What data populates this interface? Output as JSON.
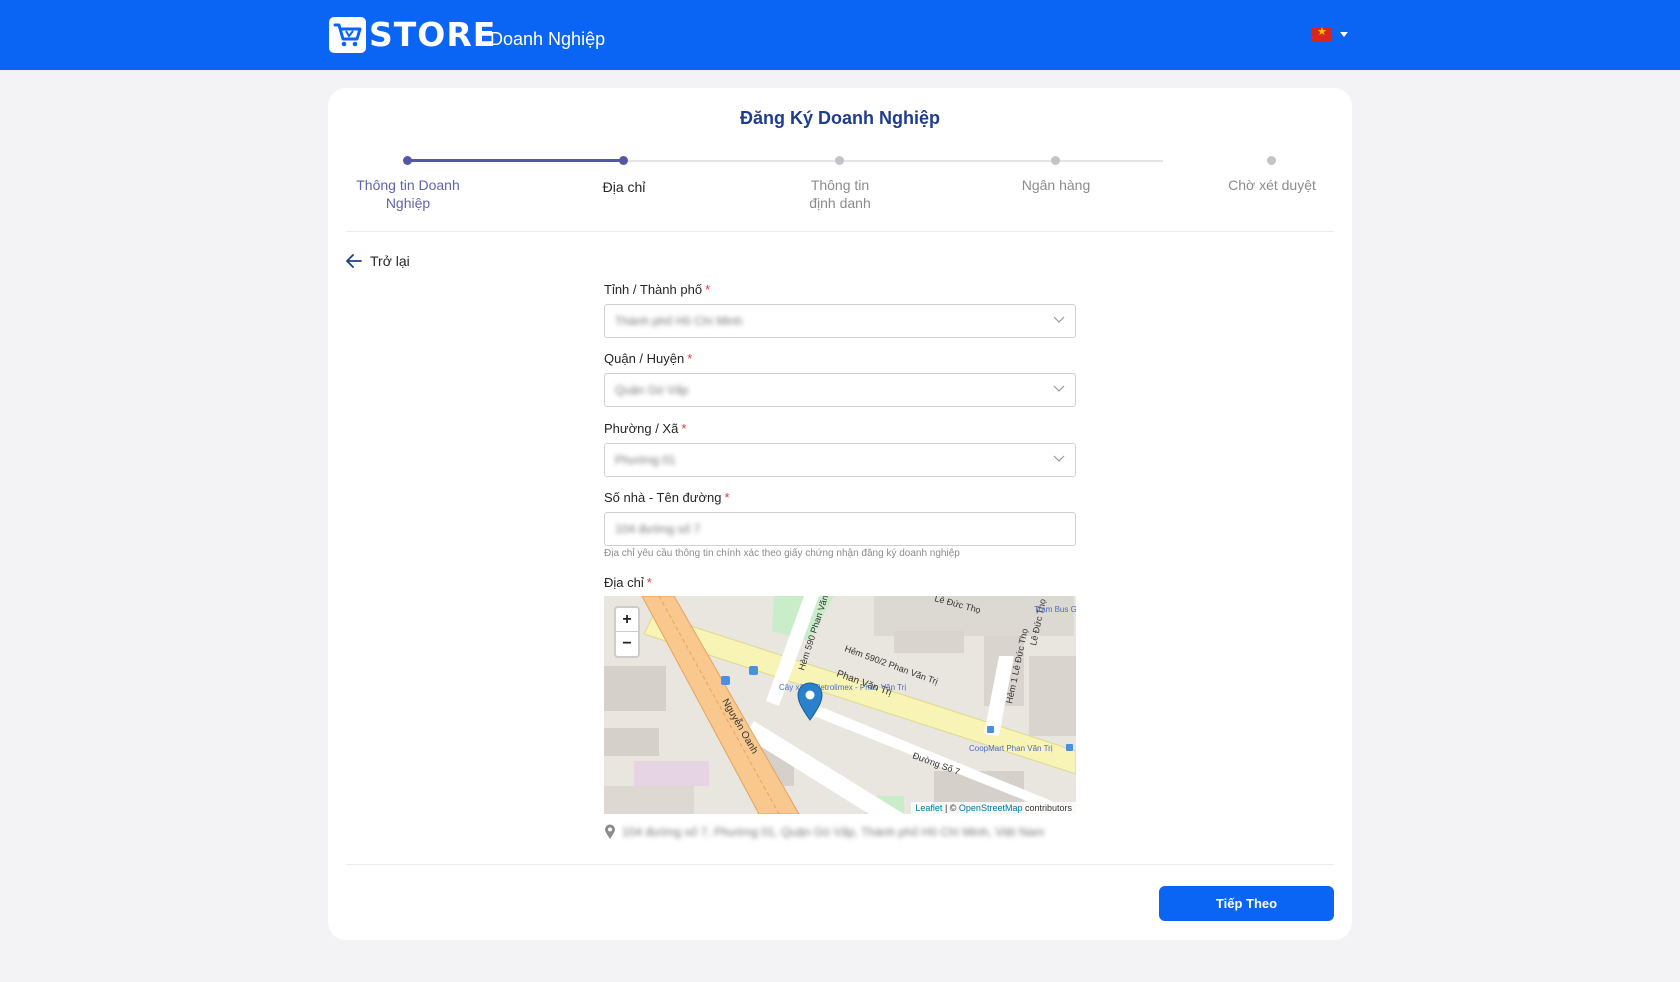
{
  "header": {
    "logo_text": "STORE",
    "subtitle": "Doanh Nghiệp",
    "language_flag": "vn-flag-icon",
    "accent_color": "#0a65f5"
  },
  "page": {
    "title": "Đăng Ký Doanh Nghiệp"
  },
  "steps": [
    {
      "label": "Thông tin Doanh Nghiệp",
      "state": "done"
    },
    {
      "label": "Địa chỉ",
      "state": "active"
    },
    {
      "label": "Thông tin định danh",
      "state": "pending"
    },
    {
      "label": "Ngân hàng",
      "state": "pending"
    },
    {
      "label": "Chờ xét duyệt",
      "state": "pending"
    }
  ],
  "back": {
    "label": "Trở lại"
  },
  "form": {
    "province": {
      "label": "Tỉnh / Thành phố",
      "required": "*",
      "value": "Thành phố Hồ Chí Minh"
    },
    "district": {
      "label": "Quận / Huyện",
      "required": "*",
      "value": "Quận Gò Vấp"
    },
    "ward": {
      "label": "Phường / Xã",
      "required": "*",
      "value": "Phường 01"
    },
    "street": {
      "label": "Số nhà - Tên đường",
      "required": "*",
      "value": "104 đường số 7",
      "hint": "Địa chỉ yêu cầu thông tin chính xác theo giấy chứng nhận đăng ký doanh nghiệp"
    },
    "address": {
      "label": "Địa chỉ",
      "required": "*",
      "value": "104 đường số 7, Phường 01, Quận Gò Vấp, Thành phố Hồ Chí Minh, Việt Nam"
    }
  },
  "map": {
    "zoom_in": "+",
    "zoom_out": "−",
    "attribution_leaflet": "Leaflet",
    "attribution_sep": " | © ",
    "attribution_osm": "OpenStreetMap",
    "attribution_tail": " contributors",
    "streets": [
      "Phan Văn Trị",
      "Hẻm 590/2 Phan Văn Trị",
      "Hẻm 590 Phan Văn",
      "Nguyễn Oanh",
      "Đường Số 7",
      "Hẻm 1 Lê Đức Thọ",
      "Lê Đức Thọ",
      "Lê Đức Thọ"
    ],
    "pois": [
      "Cây xăng Petrolimex - Phan Văn Trị",
      "CoopMart Phan Văn Trị",
      "Trạm Bus Gò Lộ Nguy Huy Đ"
    ]
  },
  "actions": {
    "next_label": "Tiếp Theo"
  }
}
